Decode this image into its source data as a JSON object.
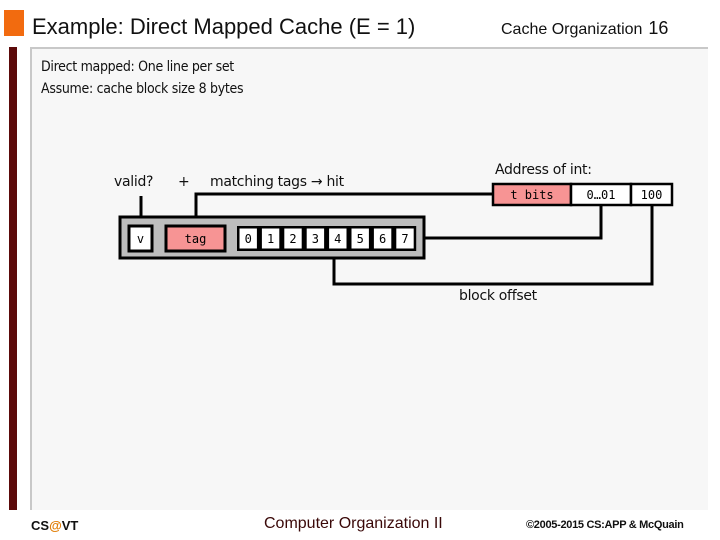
{
  "header": {
    "title": "Example: Direct Mapped Cache (E = 1)",
    "section": "Cache Organization",
    "slide_number": "16"
  },
  "intro": {
    "line1": "Direct mapped: One line per set",
    "line2": "Assume: cache block size 8 bytes"
  },
  "diagram": {
    "valid_label": "valid?",
    "plus_label": "+",
    "match_label": "matching tags → hit",
    "cache_line": {
      "valid_cell": "v",
      "tag_cell": "tag",
      "bytes": [
        "0",
        "1",
        "2",
        "3",
        "4",
        "5",
        "6",
        "7"
      ]
    },
    "address": {
      "label": "Address of int:",
      "fields": [
        "t bits",
        "0…01",
        "100"
      ]
    },
    "block_offset_label": "block offset",
    "colors": {
      "tag_fill": "#f79494",
      "line_fill": "#bdbdbd",
      "stroke": "#000000"
    }
  },
  "footer": {
    "left_prefix": "CS",
    "left_at": "@",
    "left_suffix": "VT",
    "center": "Computer Organization II",
    "right": "©2005-2015 CS:APP & McQuain"
  }
}
